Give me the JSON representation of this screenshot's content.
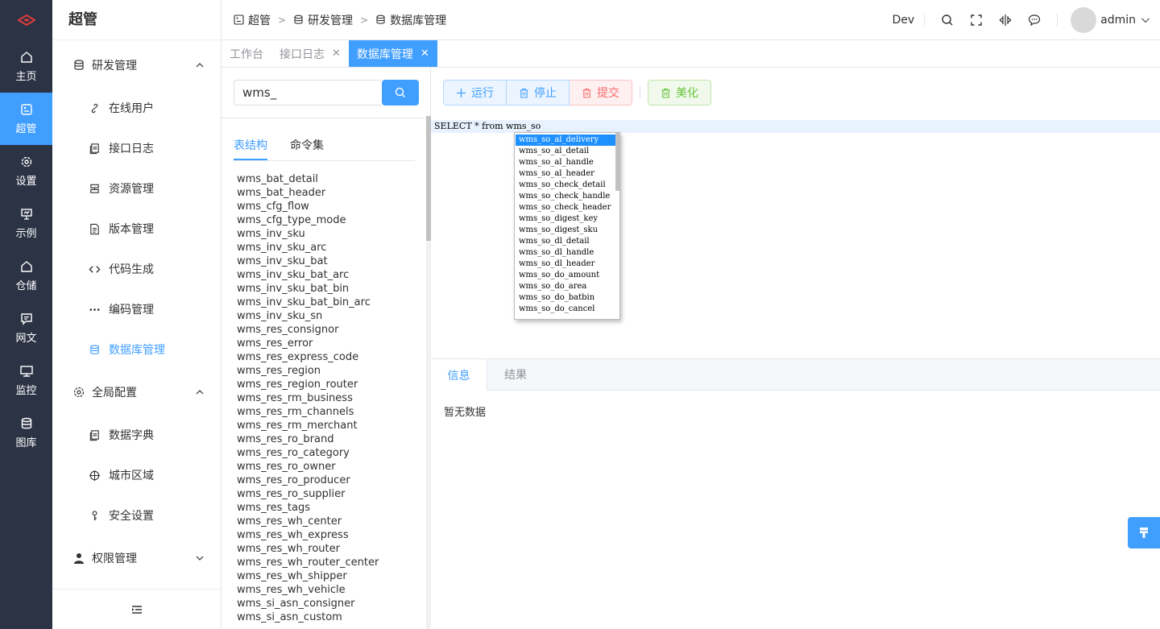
{
  "rail": {
    "items": [
      {
        "label": "主页",
        "icon": "home-icon"
      },
      {
        "label": "超管",
        "icon": "admin-icon"
      },
      {
        "label": "设置",
        "icon": "gear-icon"
      },
      {
        "label": "示例",
        "icon": "presentation-icon"
      },
      {
        "label": "仓储",
        "icon": "warehouse-icon"
      },
      {
        "label": "网文",
        "icon": "message-icon"
      },
      {
        "label": "监控",
        "icon": "monitor-icon"
      },
      {
        "label": "图库",
        "icon": "database-icon"
      }
    ]
  },
  "sidebar": {
    "title": "超管",
    "groups": [
      {
        "label": "研发管理",
        "items": [
          "在线用户",
          "接口日志",
          "资源管理",
          "版本管理",
          "代码生成",
          "编码管理",
          "数据库管理"
        ]
      },
      {
        "label": "全局配置",
        "items": [
          "数据字典",
          "城市区域",
          "安全设置"
        ]
      },
      {
        "label": "权限管理",
        "items": []
      }
    ]
  },
  "header": {
    "breadcrumb": [
      "超管",
      "研发管理",
      "数据库管理"
    ],
    "env": "Dev",
    "username": "admin"
  },
  "tabs": [
    {
      "label": "工作台"
    },
    {
      "label": "接口日志"
    },
    {
      "label": "数据库管理"
    }
  ],
  "search": {
    "value": "wms_"
  },
  "subtabs": [
    "表结构",
    "命令集"
  ],
  "tables": [
    "wms_bat_detail",
    "wms_bat_header",
    "wms_cfg_flow",
    "wms_cfg_type_mode",
    "wms_inv_sku",
    "wms_inv_sku_arc",
    "wms_inv_sku_bat",
    "wms_inv_sku_bat_arc",
    "wms_inv_sku_bat_bin",
    "wms_inv_sku_bat_bin_arc",
    "wms_inv_sku_sn",
    "wms_res_consignor",
    "wms_res_error",
    "wms_res_express_code",
    "wms_res_region",
    "wms_res_region_router",
    "wms_res_rm_business",
    "wms_res_rm_channels",
    "wms_res_rm_merchant",
    "wms_res_ro_brand",
    "wms_res_ro_category",
    "wms_res_ro_owner",
    "wms_res_ro_producer",
    "wms_res_ro_supplier",
    "wms_res_tags",
    "wms_res_wh_center",
    "wms_res_wh_express",
    "wms_res_wh_router",
    "wms_res_wh_router_center",
    "wms_res_wh_shipper",
    "wms_res_wh_vehicle",
    "wms_si_asn_consigner",
    "wms_si_asn_custom"
  ],
  "toolbar": {
    "run": "运行",
    "stop": "停止",
    "submit": "提交",
    "beautify": "美化"
  },
  "editor": {
    "sql": "SELECT * from wms_so"
  },
  "hints": [
    "wms_so_al_delivery",
    "wms_so_al_detail",
    "wms_so_al_handle",
    "wms_so_al_header",
    "wms_so_check_detail",
    "wms_so_check_handle",
    "wms_so_check_header",
    "wms_so_digest_key",
    "wms_so_digest_sku",
    "wms_so_dl_detail",
    "wms_so_dl_handle",
    "wms_so_dl_header",
    "wms_so_do_amount",
    "wms_so_do_area",
    "wms_so_do_batbin",
    "wms_so_do_cancel"
  ],
  "result": {
    "tabs": [
      "信息",
      "结果"
    ],
    "empty": "暂无数据"
  },
  "colors": {
    "accent": "#409eff",
    "rail_bg": "#2b3345",
    "danger": "#f56c6c",
    "success": "#67c23a"
  }
}
